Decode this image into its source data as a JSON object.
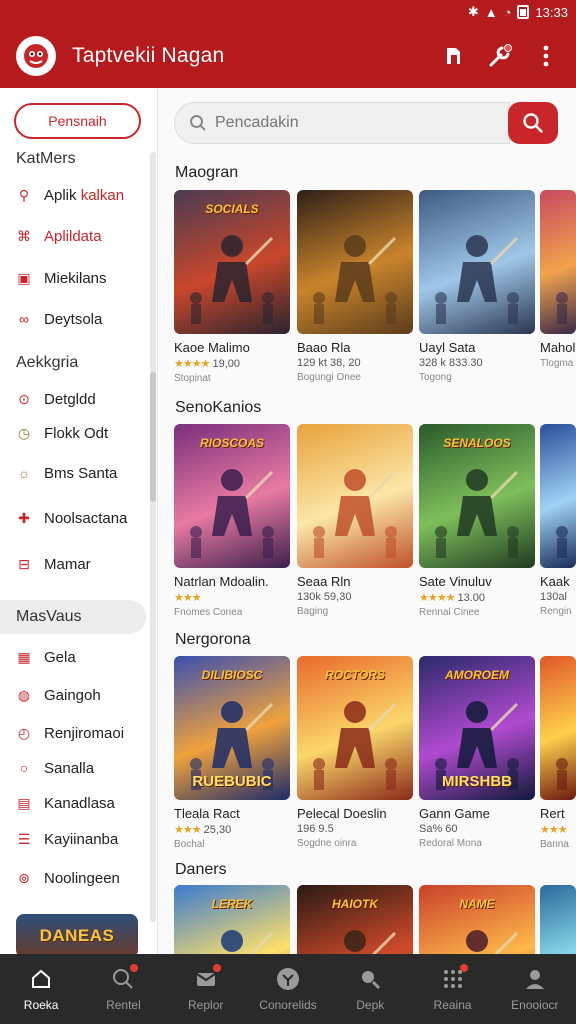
{
  "status": {
    "time": "13:33"
  },
  "appbar": {
    "title": "Taptvekii Nagan"
  },
  "sidebar": {
    "button_label": "Pensnaih",
    "heading_1": "KatMers",
    "group_1": [
      {
        "label": "Aplik",
        "suffix": "kalkan",
        "icon": "search-icon"
      },
      {
        "label": "Aplildata",
        "suffix": "",
        "icon": "gamepad-icon"
      },
      {
        "label": "Miekilans",
        "suffix": "",
        "icon": "image-icon"
      },
      {
        "label": "Deytsola",
        "suffix": "",
        "icon": "link-icon"
      }
    ],
    "heading_2": "Aekkgria",
    "group_2": [
      {
        "label": "Detgldd",
        "icon": "circle-dot-icon"
      },
      {
        "label": "Flokk Odt",
        "icon": "clock-icon"
      },
      {
        "label": "Bms Santa",
        "icon": "brightness-icon"
      },
      {
        "label": "Noolsactana",
        "icon": "puzzle-icon"
      },
      {
        "label": "Mamar",
        "icon": "minus-box-icon"
      }
    ],
    "active_item": "MasVaus",
    "group_3": [
      {
        "label": "Gela",
        "icon": "grid-icon"
      },
      {
        "label": "Gaingoh",
        "icon": "compass-icon"
      },
      {
        "label": "Renjiromaoi",
        "icon": "timer-icon"
      },
      {
        "label": "Sanalla",
        "icon": "ring-icon"
      },
      {
        "label": "Kanadlasa",
        "icon": "tag-icon"
      },
      {
        "label": "Kayiinanba",
        "icon": "list-icon"
      },
      {
        "label": "Noolingeen",
        "icon": "settings-circle-icon"
      }
    ],
    "promo_label": "DANEAS"
  },
  "search": {
    "placeholder": "Pencadakin"
  },
  "sections": [
    {
      "title": "Maogran",
      "cards": [
        {
          "banner": "SOCIALS",
          "bottom": "",
          "name": "Kaoe Malimo",
          "rating": "★★★★",
          "score": "19,00",
          "sub": "Stopinat"
        },
        {
          "banner": "",
          "bottom": "",
          "name": "Baao Rla",
          "rating": "",
          "score": "129 kt 38, 20",
          "sub": "Bogungi Onee"
        },
        {
          "banner": "",
          "bottom": "",
          "name": "Uayl Sata",
          "rating": "",
          "score": "328 k 833.30",
          "sub": "Togong"
        },
        {
          "banner": "",
          "bottom": "",
          "name": "Mahol",
          "rating": "",
          "score": "",
          "sub": "Tlogma"
        }
      ]
    },
    {
      "title": "SenoKanios",
      "cards": [
        {
          "banner": "RIOSCOAS",
          "bottom": "",
          "name": "Natrlan Mdoalin.",
          "rating": "★★★",
          "score": "",
          "sub": "Fnomes Conea"
        },
        {
          "banner": "",
          "bottom": "",
          "name": "Seaa Rln",
          "rating": "",
          "score": "130k 59,30",
          "sub": "Baging"
        },
        {
          "banner": "SENALOOS",
          "bottom": "",
          "name": "Sate Vinuluv",
          "rating": "★★★★",
          "score": "13.00",
          "sub": "Rennal Cinee"
        },
        {
          "banner": "",
          "bottom": "",
          "name": "Kaak",
          "rating": "",
          "score": "130al",
          "sub": "Rengin"
        }
      ]
    },
    {
      "title": "Nergorona",
      "cards": [
        {
          "banner": "DILIBIOSC",
          "bottom": "RUEBUBIC",
          "name": "Tleala Ract",
          "rating": "★★★",
          "score": "25,30",
          "sub": "Bochal"
        },
        {
          "banner": "ROCTORS",
          "bottom": "",
          "name": "Pelecal Doeslin",
          "rating": "",
          "score": "196 9.5",
          "sub": "Sogdne oinra"
        },
        {
          "banner": "AMOROEM",
          "bottom": "MIRSHBB",
          "name": "Gann Game",
          "rating": "",
          "score": "Sa% 60",
          "sub": "Redoral Mona"
        },
        {
          "banner": "",
          "bottom": "",
          "name": "Rert",
          "rating": "★★★",
          "score": "",
          "sub": "Banna"
        }
      ]
    },
    {
      "title": "Daners",
      "cards": [
        {
          "banner": "LEREK",
          "bottom": "",
          "name": "",
          "rating": "",
          "score": "",
          "sub": ""
        },
        {
          "banner": "HAIOTK",
          "bottom": "",
          "name": "",
          "rating": "",
          "score": "",
          "sub": ""
        },
        {
          "banner": "NAME",
          "bottom": "",
          "name": "",
          "rating": "",
          "score": "",
          "sub": ""
        },
        {
          "banner": "",
          "bottom": "",
          "name": "",
          "rating": "",
          "score": "",
          "sub": ""
        }
      ]
    }
  ],
  "bottomnav": [
    {
      "label": "Roeka",
      "icon": "home-icon",
      "active": true
    },
    {
      "label": "Rentel",
      "icon": "search-icon",
      "active": false
    },
    {
      "label": "Replor",
      "icon": "mail-icon",
      "active": false
    },
    {
      "label": "Conorelids",
      "icon": "compass-icon",
      "active": false
    },
    {
      "label": "Depk",
      "icon": "magnifier-icon",
      "active": false
    },
    {
      "label": "Reaina",
      "icon": "grid-icon",
      "active": false
    },
    {
      "label": "Enooiocr",
      "icon": "profile-icon",
      "active": false
    }
  ]
}
